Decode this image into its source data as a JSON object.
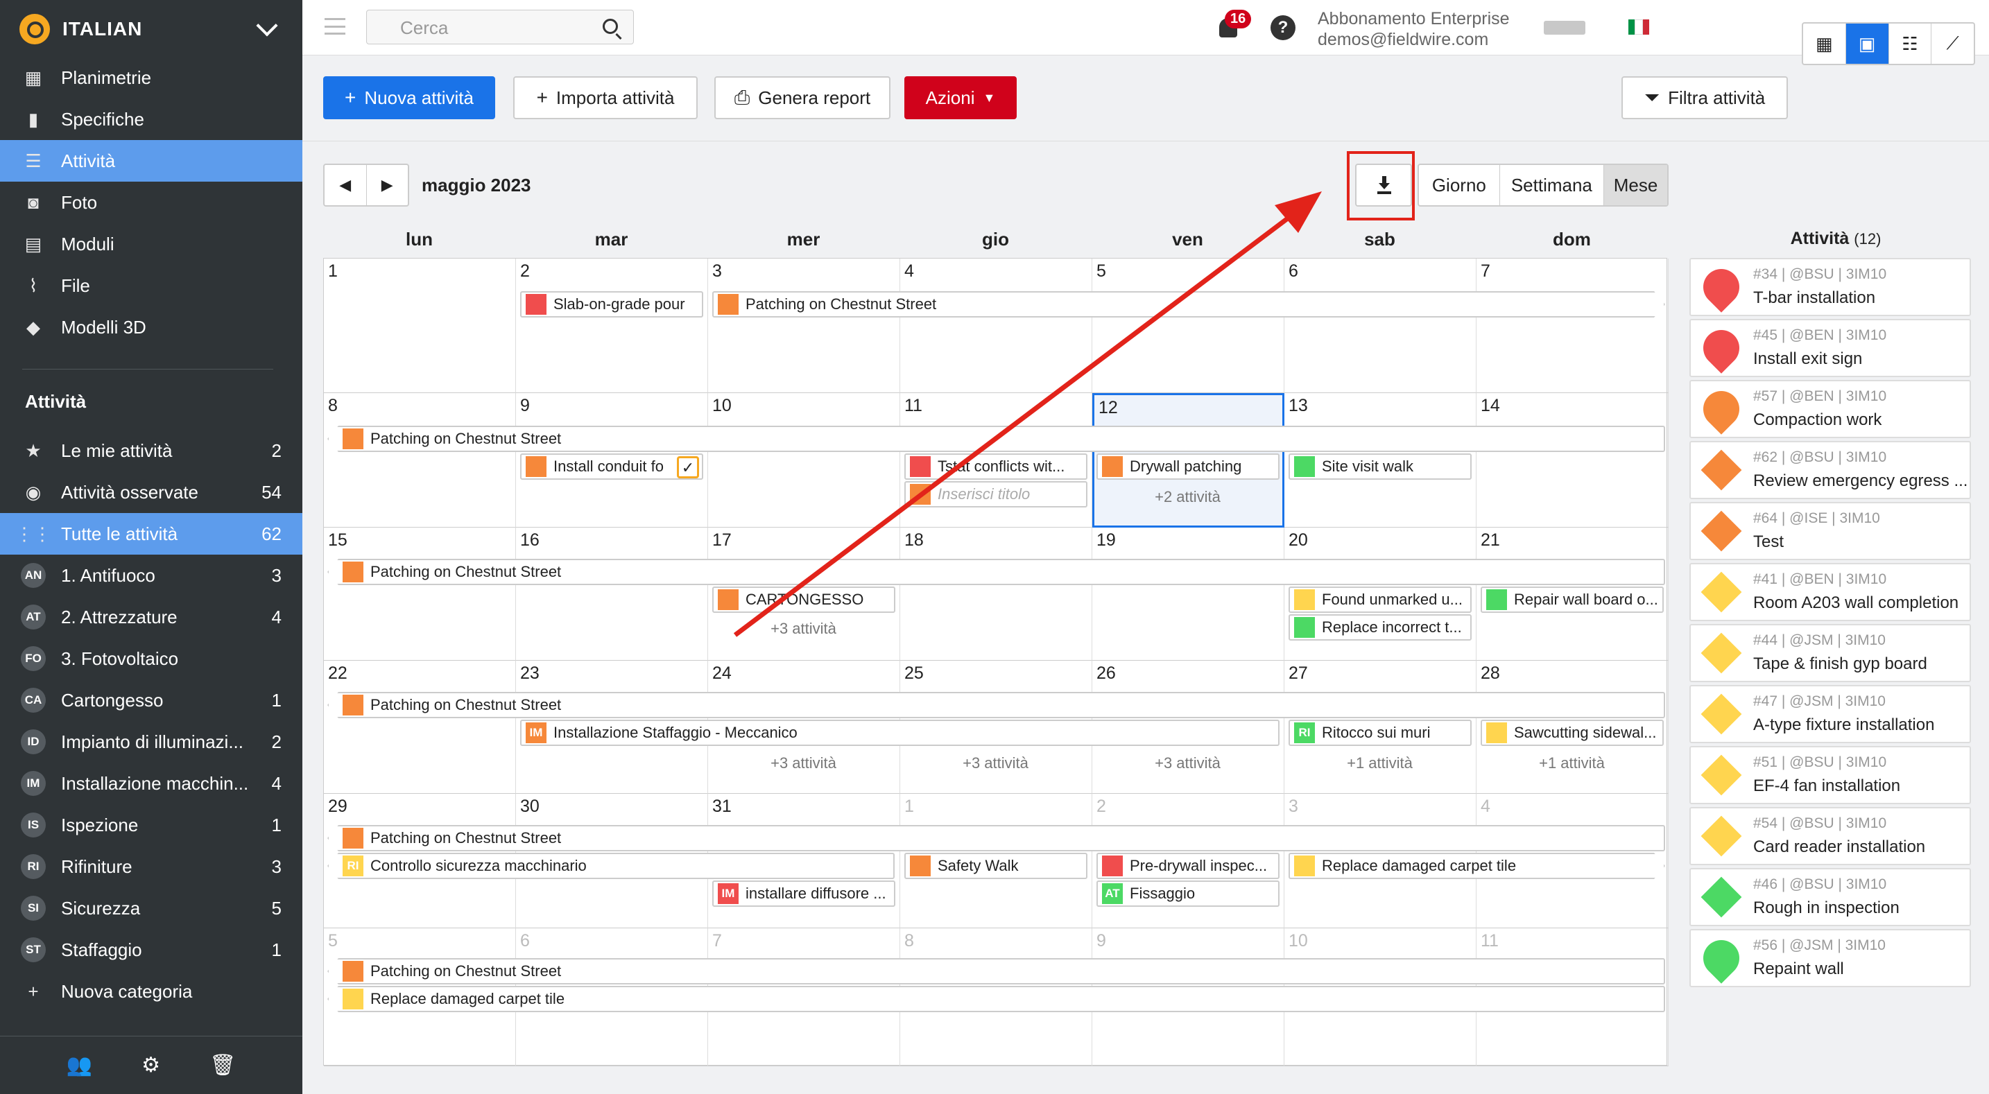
{
  "project": {
    "name": "ITALIAN"
  },
  "sidebar": {
    "nav": [
      {
        "label": "Planimetrie",
        "icon": "blueprint-icon"
      },
      {
        "label": "Specifiche",
        "icon": "book-icon"
      },
      {
        "label": "Attività",
        "icon": "list-icon"
      },
      {
        "label": "Foto",
        "icon": "camera-icon"
      },
      {
        "label": "Moduli",
        "icon": "clipboard-icon"
      },
      {
        "label": "File",
        "icon": "paperclip-icon"
      },
      {
        "label": "Modelli 3D",
        "icon": "cube-icon"
      }
    ],
    "section_title": "Attività",
    "filters": [
      {
        "label": "Le mie attività",
        "count": "2",
        "icon": "star-icon"
      },
      {
        "label": "Attività osservate",
        "count": "54",
        "icon": "eye-icon"
      },
      {
        "label": "Tutte le attività",
        "count": "62",
        "icon": "grid-icon"
      }
    ],
    "categories": [
      {
        "abbr": "AN",
        "label": "1. Antifuoco",
        "count": "3"
      },
      {
        "abbr": "AT",
        "label": "2. Attrezzature",
        "count": "4"
      },
      {
        "abbr": "FO",
        "label": "3. Fotovoltaico",
        "count": ""
      },
      {
        "abbr": "CA",
        "label": "Cartongesso",
        "count": "1"
      },
      {
        "abbr": "ID",
        "label": "Impianto di illuminazi...",
        "count": "2"
      },
      {
        "abbr": "IM",
        "label": "Installazione macchin...",
        "count": "4"
      },
      {
        "abbr": "IS",
        "label": "Ispezione",
        "count": "1"
      },
      {
        "abbr": "RI",
        "label": "Rifiniture",
        "count": "3"
      },
      {
        "abbr": "SI",
        "label": "Sicurezza",
        "count": "5"
      },
      {
        "abbr": "ST",
        "label": "Staffaggio",
        "count": "1"
      }
    ],
    "new_category": "Nuova categoria"
  },
  "topbar": {
    "search_placeholder": "Cerca",
    "notifications": "16",
    "account_plan": "Abbonamento Enterprise",
    "account_email": "demos@fieldwire.com",
    "flag_colors": [
      "#009246",
      "#ffffff",
      "#ce2b37"
    ]
  },
  "toolbar": {
    "new_task": "Nuova attività",
    "import": "Importa attività",
    "report": "Genera report",
    "actions": "Azioni",
    "filter": "Filtra attività"
  },
  "calendar": {
    "month": "maggio 2023",
    "views": [
      "Giorno",
      "Settimana",
      "Mese"
    ],
    "selected_view": "Mese",
    "weekdays": [
      "lun",
      "mar",
      "mer",
      "gio",
      "ven",
      "sab",
      "dom"
    ],
    "weeks": [
      [
        "1",
        "2",
        "3",
        "4",
        "5",
        "6",
        "7"
      ],
      [
        "8",
        "9",
        "10",
        "11",
        "12",
        "13",
        "14"
      ],
      [
        "15",
        "16",
        "17",
        "18",
        "19",
        "20",
        "21"
      ],
      [
        "22",
        "23",
        "24",
        "25",
        "26",
        "27",
        "28"
      ],
      [
        "29",
        "30",
        "31",
        "1",
        "2",
        "3",
        "4"
      ],
      [
        "5",
        "6",
        "7",
        "8",
        "9",
        "10",
        "11"
      ]
    ],
    "events": {
      "w0a": "Slab-on-grade pour",
      "w0b": "Patching on Chestnut Street",
      "w1a": "Patching on Chestnut Street",
      "w1b": "Install conduit fo",
      "w1c": "Tstat conflicts wit...",
      "w1d": "Inserisci titolo",
      "w1e": "Drywall patching",
      "w1f": "Site visit walk",
      "w1more": "+2 attività",
      "w2a": "Patching on Chestnut Street",
      "w2b": "CARTONGESSO",
      "w2c": "Found unmarked u...",
      "w2d": "Repair wall board o...",
      "w2e": "Replace incorrect t...",
      "w2more": "+3 attività",
      "w3a": "Patching on Chestnut Street",
      "w3b": "Installazione Staffaggio - Meccanico",
      "w3c": "Ritocco sui muri",
      "w3d": "Sawcutting sidewal...",
      "w3more1": "+3 attività",
      "w3more2": "+3 attività",
      "w3more3": "+3 attività",
      "w3more4": "+1 attività",
      "w3more5": "+1 attività",
      "w4a": "Patching on Chestnut Street",
      "w4b": "Controllo sicurezza macchinario",
      "w4c": "Safety Walk",
      "w4d": "Pre-drywall inspec...",
      "w4e": "Replace damaged carpet tile",
      "w4f": "installare diffusore ...",
      "w4g": "Fissaggio",
      "w5a": "Patching on Chestnut Street",
      "w5b": "Replace damaged carpet tile"
    }
  },
  "panel": {
    "title": "Attività",
    "count": "(12)",
    "tasks": [
      {
        "meta": "#34 | @BSU | 3IM10",
        "name": "T-bar installation",
        "color": "#f04d4d",
        "shape": "pin"
      },
      {
        "meta": "#45 | @BEN | 3IM10",
        "name": "Install exit sign",
        "color": "#f04d4d",
        "shape": "pin"
      },
      {
        "meta": "#57 | @BEN | 3IM10",
        "name": "Compaction work",
        "color": "#f6883a",
        "shape": "pin"
      },
      {
        "meta": "#62 | @BSU | 3IM10",
        "name": "Review emergency egress ...",
        "color": "#f6883a",
        "shape": "diamond"
      },
      {
        "meta": "#64 | @ISE | 3IM10",
        "name": "Test",
        "color": "#f6883a",
        "shape": "diamond"
      },
      {
        "meta": "#41 | @BEN | 3IM10",
        "name": "Room A203 wall completion",
        "color": "#ffd54f",
        "shape": "diamond"
      },
      {
        "meta": "#44 | @JSM | 3IM10",
        "name": "Tape & finish gyp board",
        "color": "#ffd54f",
        "shape": "diamond"
      },
      {
        "meta": "#47 | @JSM | 3IM10",
        "name": "A-type fixture installation",
        "color": "#ffd54f",
        "shape": "diamond"
      },
      {
        "meta": "#51 | @BSU | 3IM10",
        "name": "EF-4 fan installation",
        "color": "#ffd54f",
        "shape": "diamond"
      },
      {
        "meta": "#54 | @BSU | 3IM10",
        "name": "Card reader installation",
        "color": "#ffd54f",
        "shape": "diamond"
      },
      {
        "meta": "#46 | @BSU | 3IM10",
        "name": "Rough in inspection",
        "color": "#4cd964",
        "shape": "diamond"
      },
      {
        "meta": "#56 | @JSM | 3IM10",
        "name": "Repaint wall",
        "color": "#4cd964",
        "shape": "pin"
      }
    ]
  }
}
